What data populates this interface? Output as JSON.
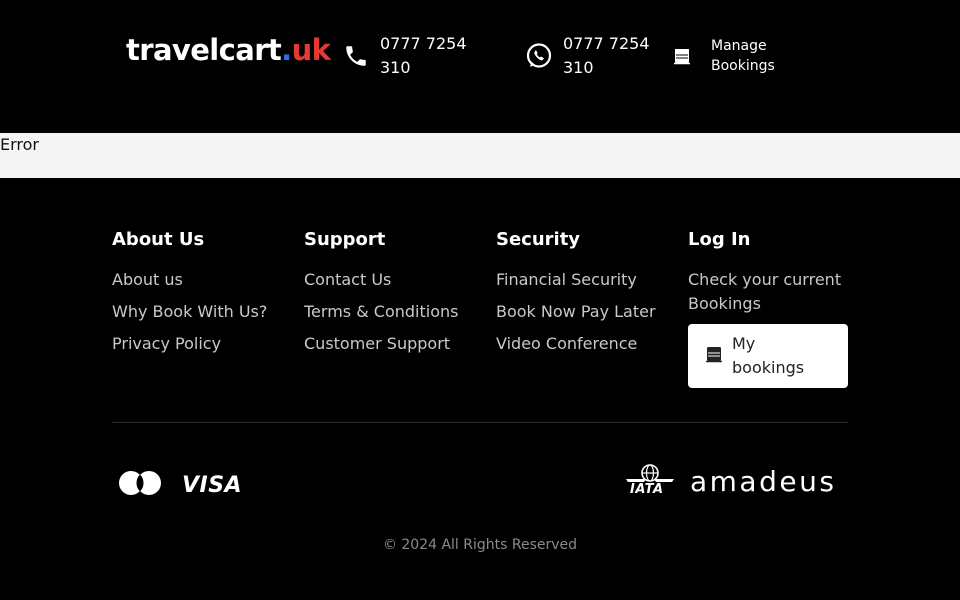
{
  "header": {
    "logo": {
      "brand": "travelcart",
      "dot": ".",
      "tld": "uk"
    },
    "phone": {
      "number": "0777 7254 310",
      "icon": "phone-icon"
    },
    "whatsapp": {
      "number": "0777 7254 310",
      "icon": "whatsapp-icon"
    },
    "manage": {
      "label": "Manage Bookings",
      "icon": "bookings-icon"
    }
  },
  "error_bar": {
    "message": "Error"
  },
  "footer": {
    "columns": [
      {
        "title": "About Us",
        "links": [
          "About us",
          "Why Book With Us?",
          "Privacy Policy"
        ]
      },
      {
        "title": "Support",
        "links": [
          "Contact Us",
          "Terms & Conditions",
          "Customer Support"
        ]
      },
      {
        "title": "Security",
        "links": [
          "Financial Security",
          "Book Now Pay Later",
          "Video Conference"
        ]
      }
    ],
    "login": {
      "title": "Log In",
      "note": "Check your current Bookings",
      "button_label": "My bookings"
    },
    "payments": {
      "visa": "VISA",
      "mastercard_icon": "mastercard-icon"
    },
    "partners": {
      "iata": "IATA",
      "amadeus": "amadeus"
    },
    "copyright": "© 2024 All Rights Reserved"
  },
  "colors": {
    "background": "#000000",
    "accent_blue": "#2f6fe0",
    "accent_red": "#e53935",
    "error_bar": "#f4f4f4"
  }
}
